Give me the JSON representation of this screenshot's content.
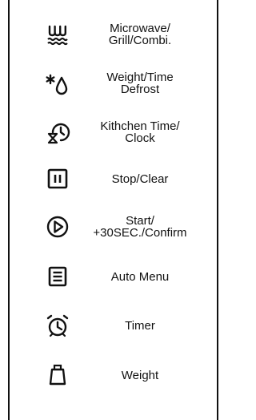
{
  "buttons": [
    {
      "icon": "microwave-grill-wave-icon",
      "line1": "Microwave/",
      "line2": "Grill/Combi."
    },
    {
      "icon": "snowflake-drop-defrost-icon",
      "line1": "Weight/Time",
      "line2": "Defrost"
    },
    {
      "icon": "clock-hourglass-icon",
      "line1": "Kithchen Time/",
      "line2": "Clock"
    },
    {
      "icon": "pause-square-icon",
      "line1": "Stop/Clear",
      "line2": ""
    },
    {
      "icon": "play-circle-icon",
      "line1": "Start/",
      "line2": "+30SEC./Confirm"
    },
    {
      "icon": "menu-list-icon",
      "line1": "Auto Menu",
      "line2": ""
    },
    {
      "icon": "alarm-clock-icon",
      "line1": "Timer",
      "line2": ""
    },
    {
      "icon": "weight-icon",
      "line1": "Weight",
      "line2": ""
    }
  ]
}
